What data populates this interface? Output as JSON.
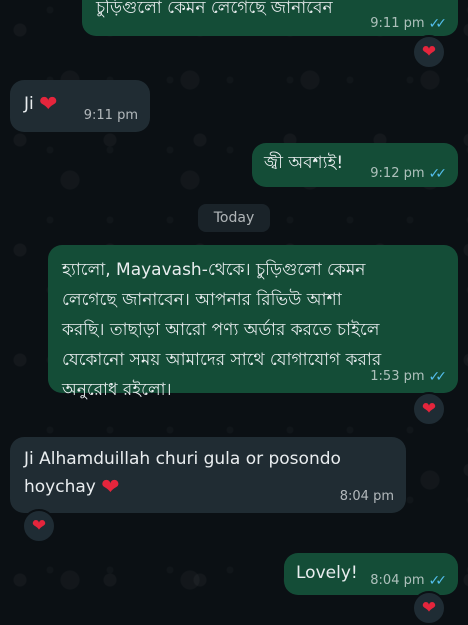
{
  "messages": [
    {
      "direction": "outgoing",
      "text": "চুড়িগুলো কেমন লেগেছে জানাবেন",
      "time": "9:11 pm",
      "status": "read",
      "reaction": "heart"
    },
    {
      "direction": "incoming",
      "text": "Ji",
      "emoji": "heart",
      "time": "9:11 pm"
    },
    {
      "direction": "outgoing",
      "text": "জ্বী অবশ্যই!",
      "time": "9:12 pm",
      "status": "read"
    },
    {
      "direction": "outgoing",
      "text": "হ্যালো, Mayavash-থেকে। চুড়িগুলো কেমন লেগেছে জানাবেন। আপনার রিভিউ আশা করছি। তাছাড়া আরো পণ্য অর্ডার করতে চাইলে যেকোনো সময় আমাদের সাথে যোগাযোগ করার অনুরোধ রইলো।",
      "time": "1:53 pm",
      "status": "read",
      "reaction": "heart"
    },
    {
      "direction": "incoming",
      "text": "Ji Alhamduillah churi gula or posondo hoychay",
      "emoji": "heart",
      "time": "8:04 pm",
      "reaction": "heart"
    },
    {
      "direction": "outgoing",
      "text": "Lovely!",
      "time": "8:04 pm",
      "status": "read",
      "reaction": "heart"
    }
  ],
  "date_separator": "Today",
  "icons": {
    "read_ticks": "double-check-icon",
    "reaction": "red-heart-icon"
  },
  "colors": {
    "background": "#0b1014",
    "outgoing_bubble": "#144d37",
    "incoming_bubble": "#202c33",
    "read_ticks": "#53bdeb",
    "heart": "#e5253c"
  }
}
